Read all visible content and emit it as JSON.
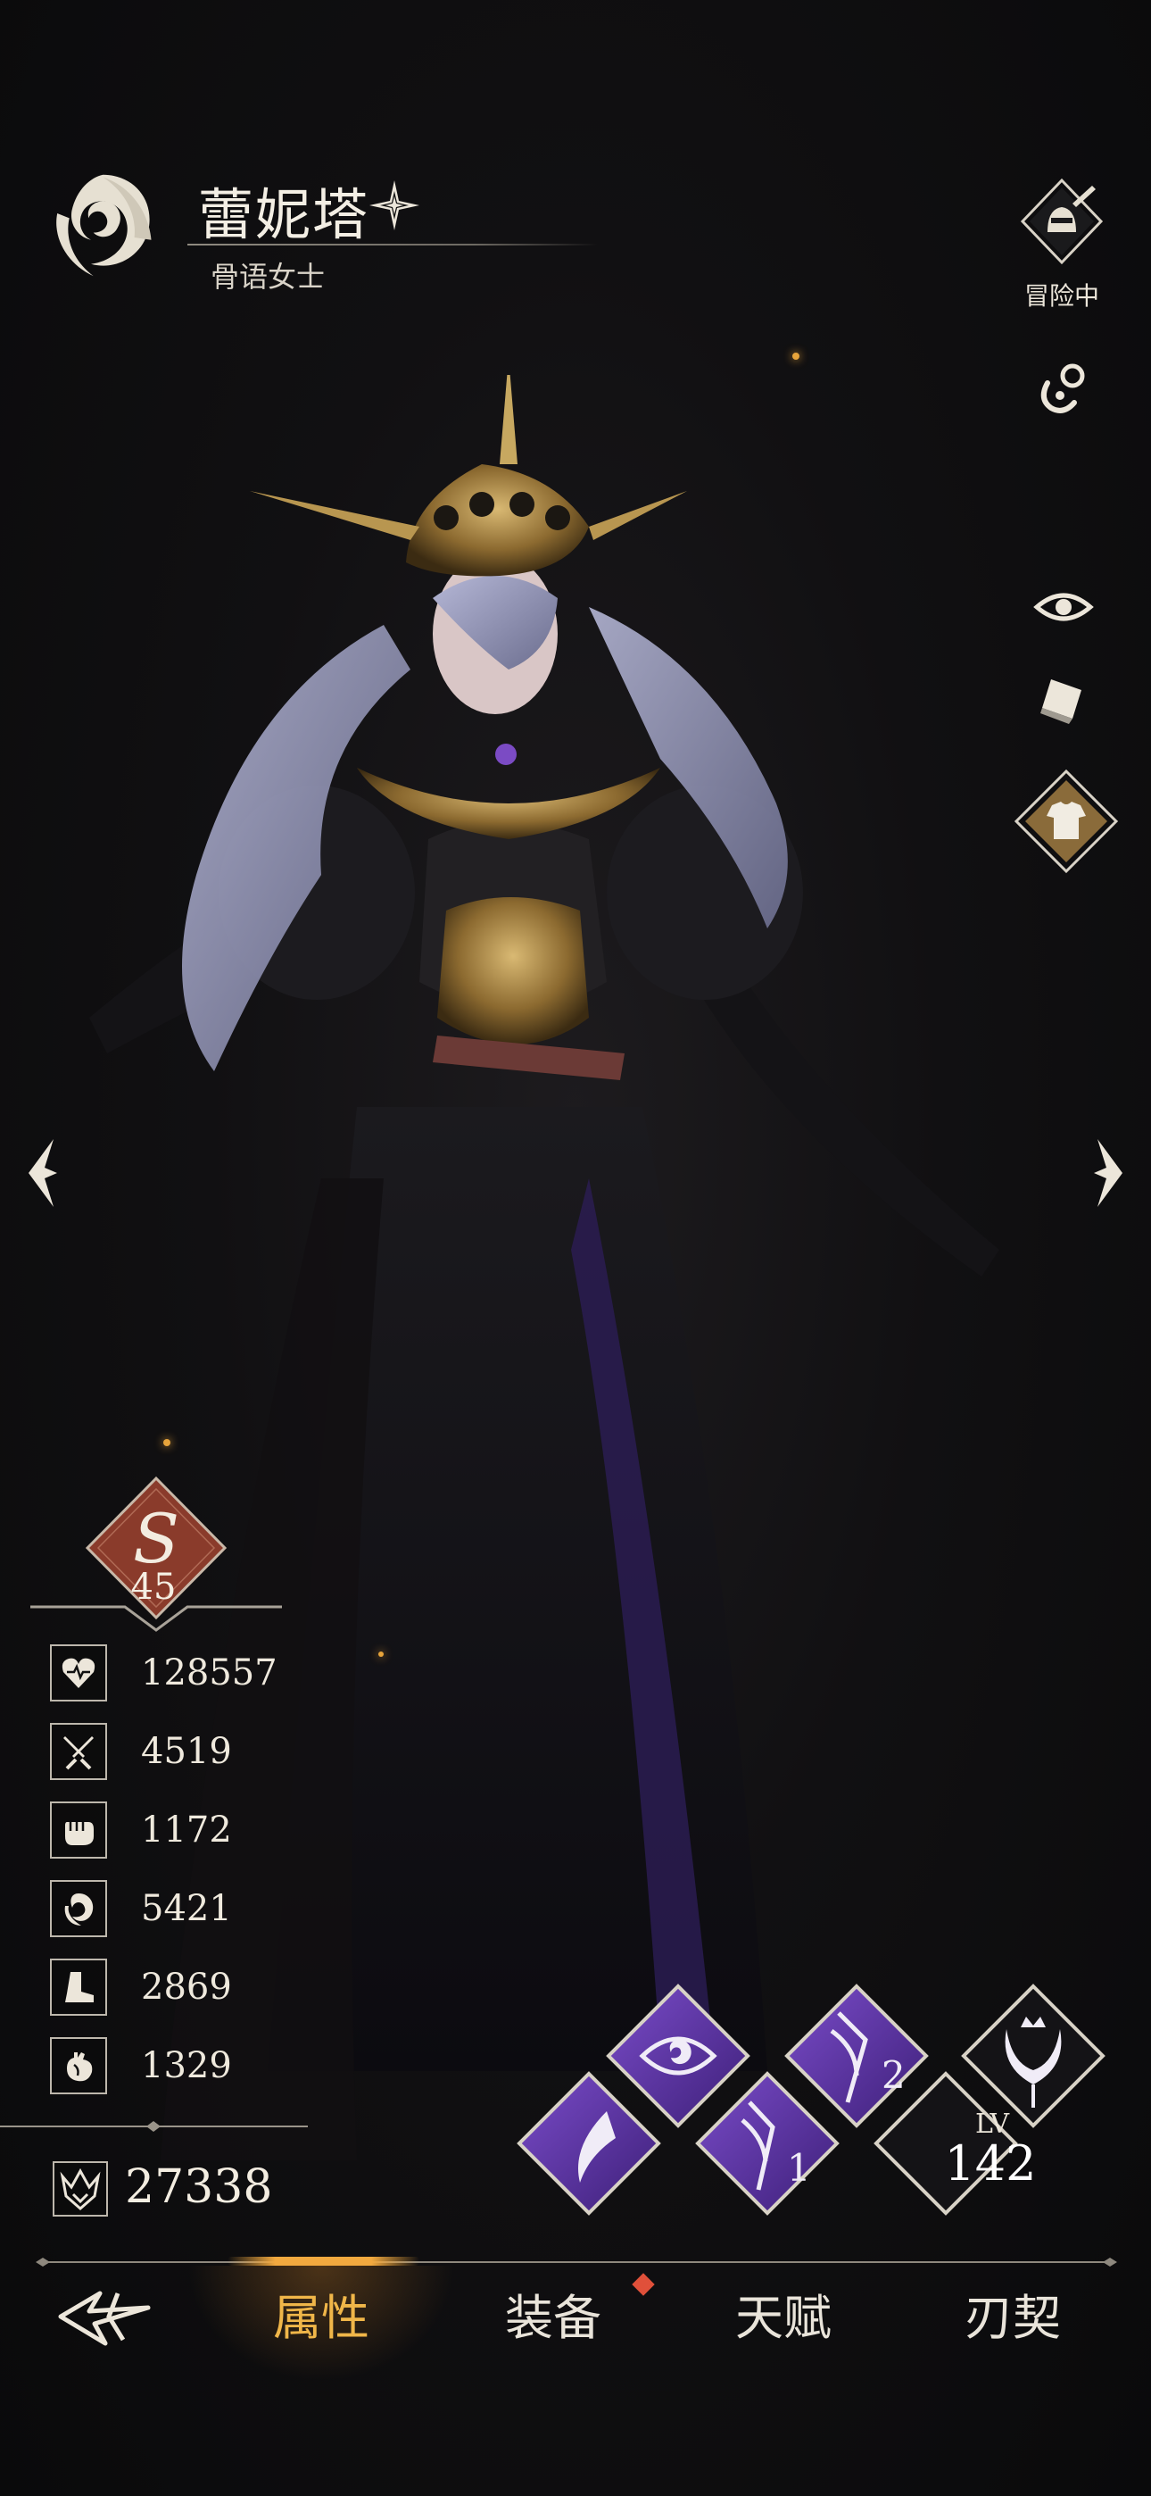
{
  "header": {
    "name": "蕾妮塔",
    "title": "骨语女士"
  },
  "side_buttons": {
    "adventure_label": "冒险中"
  },
  "rank": {
    "grade": "S",
    "level": "45"
  },
  "stats": [
    {
      "icon": "heart-icon",
      "value": "128557"
    },
    {
      "icon": "sword-icon",
      "value": "4519"
    },
    {
      "icon": "fist-icon",
      "value": "1172"
    },
    {
      "icon": "spiral-icon",
      "value": "5421"
    },
    {
      "icon": "boot-icon",
      "value": "2869"
    },
    {
      "icon": "anatomical-heart-icon",
      "value": "1329"
    }
  ],
  "power": {
    "icon": "crown-crest-icon",
    "value": "27338"
  },
  "skills": {
    "lv_label": "LV",
    "lv_value": "142",
    "slots": [
      "eye-skill",
      "blade-2-skill",
      "ultimate-skill",
      "claw-skill",
      "blade-1-skill"
    ],
    "slot_numbers": [
      "2",
      "1"
    ]
  },
  "nav": {
    "tabs": [
      "属性",
      "装备",
      "天赋",
      "刃契"
    ],
    "active_tab": "属性"
  },
  "colors": {
    "accent": "#f2a93f",
    "skill_purple": "#5b2f9e",
    "rank_red": "#8a3b2b",
    "alert": "#e0503a"
  }
}
